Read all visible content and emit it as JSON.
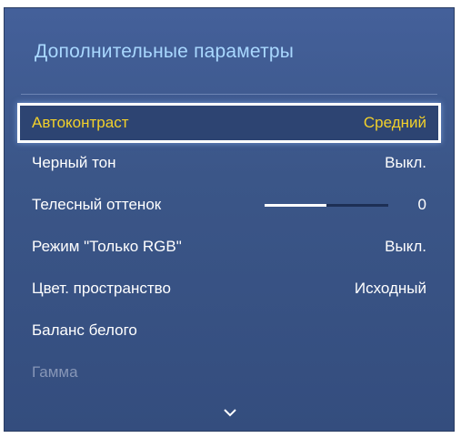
{
  "menu": {
    "title": "Дополнительные параметры",
    "items": [
      {
        "label": "Автоконтраст",
        "value": "Средний",
        "selected": true
      },
      {
        "label": "Черный тон",
        "value": "Выкл."
      },
      {
        "label": "Телесный оттенок",
        "value": "0",
        "slider_fraction": 0.5
      },
      {
        "label": "Режим \"Только RGB\"",
        "value": "Выкл."
      },
      {
        "label": "Цвет. пространство",
        "value": "Исходный"
      },
      {
        "label": "Баланс белого",
        "value": ""
      },
      {
        "label": "Гамма",
        "value": "",
        "disabled": true
      }
    ],
    "scroll_icon": "chevron-down-icon"
  },
  "colors": {
    "title": "#a9d8ff",
    "selected_text": "#f2d02a",
    "panel_background": "#3b5688",
    "disabled_text": "#8796b7"
  }
}
